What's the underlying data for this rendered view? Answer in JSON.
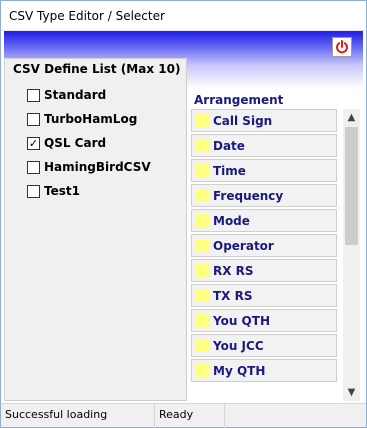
{
  "window": {
    "title": "CSV Type Editor / Selecter"
  },
  "icons": {
    "power": "power-icon"
  },
  "colors": {
    "banner_top": "#1e1ee6",
    "power_red": "#e02020",
    "arrangement_text": "#1a1a7a",
    "swatch": "#ffff80"
  },
  "define_list": {
    "title": "CSV Define List (Max 10)",
    "items": [
      {
        "label": "Standard",
        "checked": false
      },
      {
        "label": "TurboHamLog",
        "checked": false
      },
      {
        "label": "QSL Card",
        "checked": true
      },
      {
        "label": "HamingBirdCSV",
        "checked": false
      },
      {
        "label": "Test1",
        "checked": false
      }
    ]
  },
  "arrangement": {
    "label": "Arrangement",
    "items": [
      "Call Sign",
      "Date",
      "Time",
      "Frequency",
      "Mode",
      "Operator",
      "RX RS",
      "TX RS",
      "You QTH",
      "You JCC",
      "My QTH"
    ]
  },
  "status": {
    "message": "Successful loading",
    "state": "Ready"
  }
}
